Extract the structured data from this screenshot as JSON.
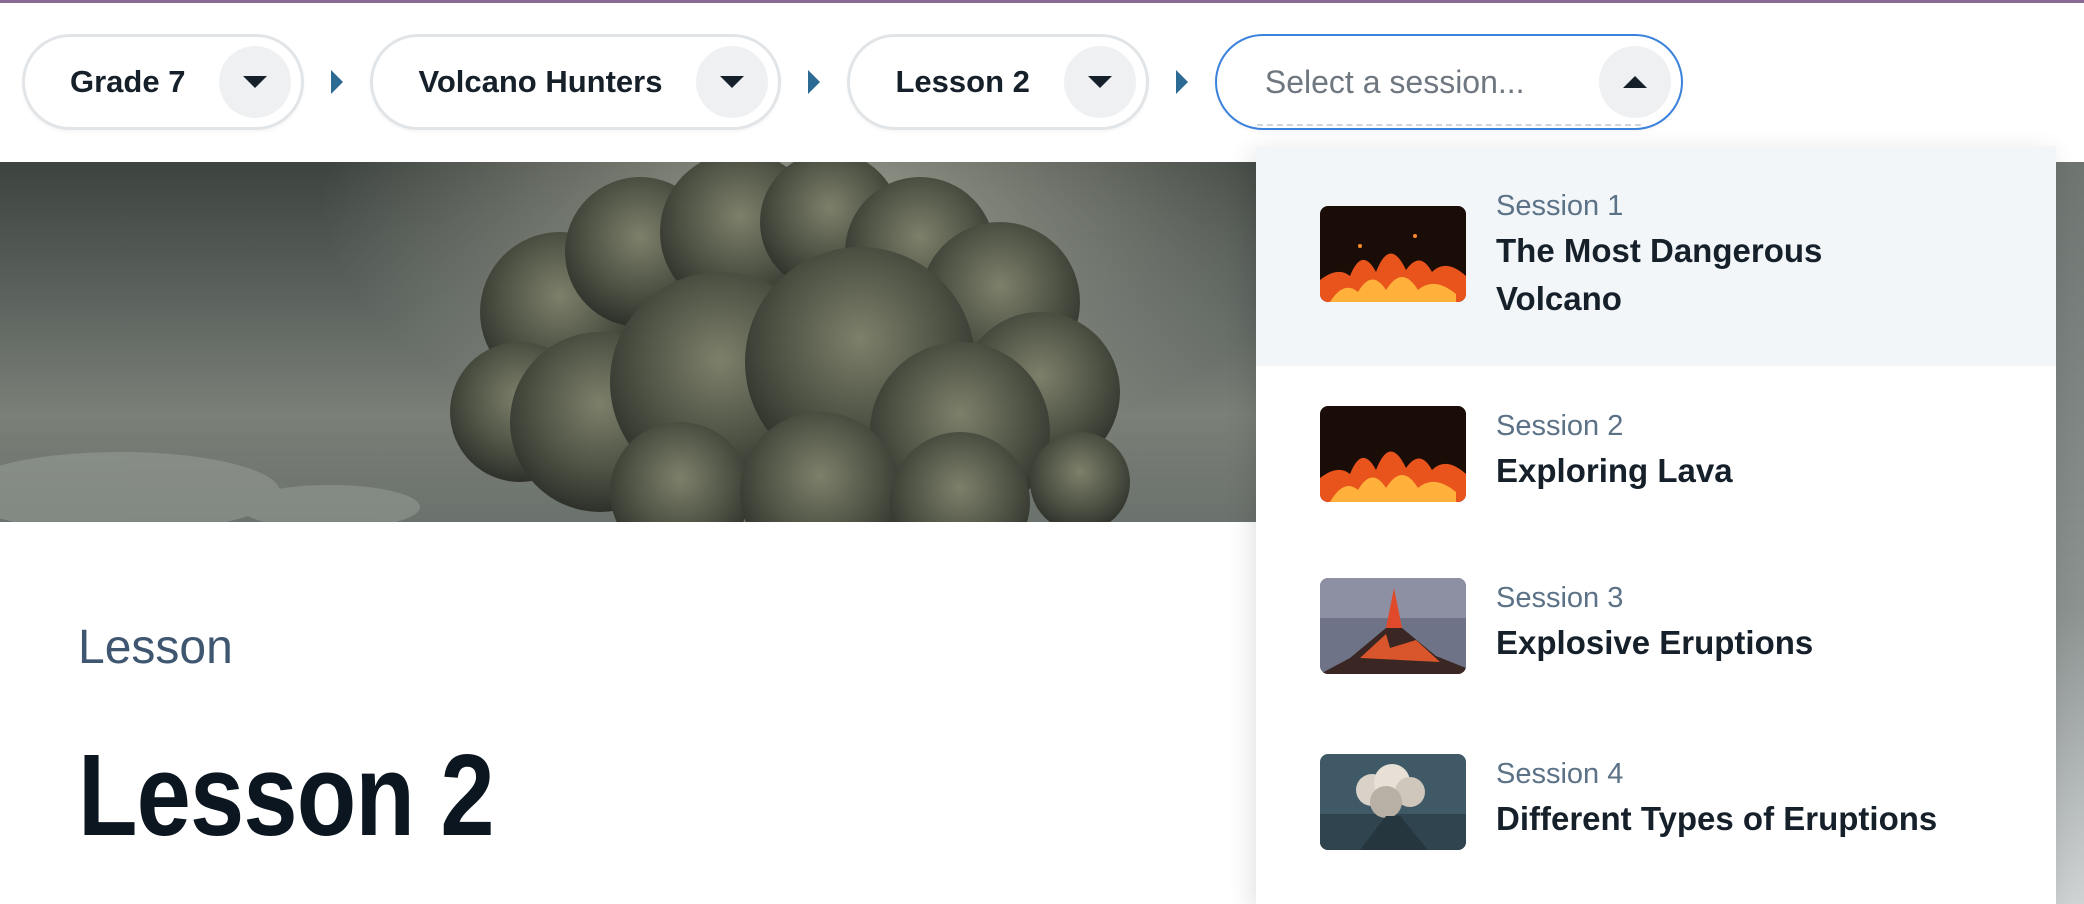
{
  "breadcrumb": {
    "grade": "Grade 7",
    "unit": "Volcano Hunters",
    "lesson": "Lesson 2",
    "session_placeholder": "Select a session..."
  },
  "page": {
    "eyebrow": "Lesson",
    "title": "Lesson 2"
  },
  "sessions": [
    {
      "session": "Session 1",
      "title_line1": "The Most Dangerous",
      "title_line2": "Volcano",
      "thumb": "lava-fire"
    },
    {
      "session": "Session 2",
      "title": "Exploring Lava",
      "thumb": "lava-fire"
    },
    {
      "session": "Session 3",
      "title": "Explosive Eruptions",
      "thumb": "erupting-volcano"
    },
    {
      "session": "Session 4",
      "title": "Different Types of Eruptions",
      "thumb": "ash-plume"
    }
  ],
  "colors": {
    "accent_blue": "#3b82dd",
    "separator": "#2c6b93",
    "eyebrow": "#3e5670",
    "active_option_bg": "#f2f6f9"
  }
}
